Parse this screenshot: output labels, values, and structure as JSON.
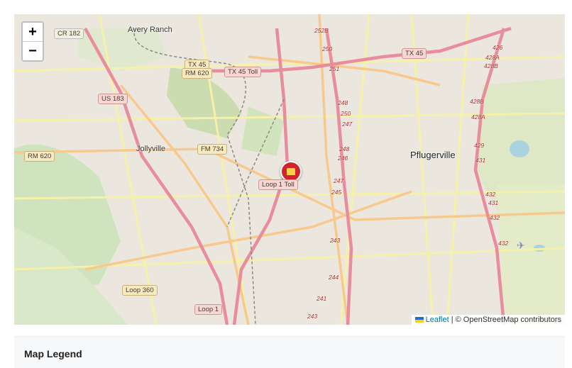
{
  "zoom_controls": {
    "zoom_in": "+",
    "zoom_out": "−"
  },
  "places": {
    "avery_ranch": "Avery Ranch",
    "jollyville": "Jollyville",
    "pflugerville": "Pflugerville"
  },
  "road_shields": {
    "cr182": "CR 182",
    "tx45_west": "TX 45",
    "rm620_top": "RM 620",
    "tx45_toll": "TX 45 Toll",
    "tx45_east": "TX 45",
    "us183": "US 183",
    "rm620_left": "RM 620",
    "fm734": "FM 734",
    "loop360": "Loop 360",
    "loop1": "Loop 1"
  },
  "exits": [
    "252B",
    "250",
    "251",
    "248",
    "250",
    "247",
    "248",
    "246",
    "247",
    "245",
    "243",
    "244",
    "241",
    "243",
    "426",
    "428A",
    "428B",
    "428B",
    "428A",
    "429",
    "431",
    "432",
    "431",
    "432",
    "432"
  ],
  "marker": {
    "label": "Loop 1 Toll"
  },
  "attribution": {
    "leaflet": "Leaflet",
    "rest": "| © OpenStreetMap contributors"
  },
  "legend": {
    "title": "Map Legend"
  },
  "colors": {
    "motorway": "#e892a2",
    "primary": "#fcd6a4",
    "secondary": "#f7fabf",
    "park": "#c8dcb4",
    "water": "#aad3df",
    "marker": "#d2232a"
  }
}
